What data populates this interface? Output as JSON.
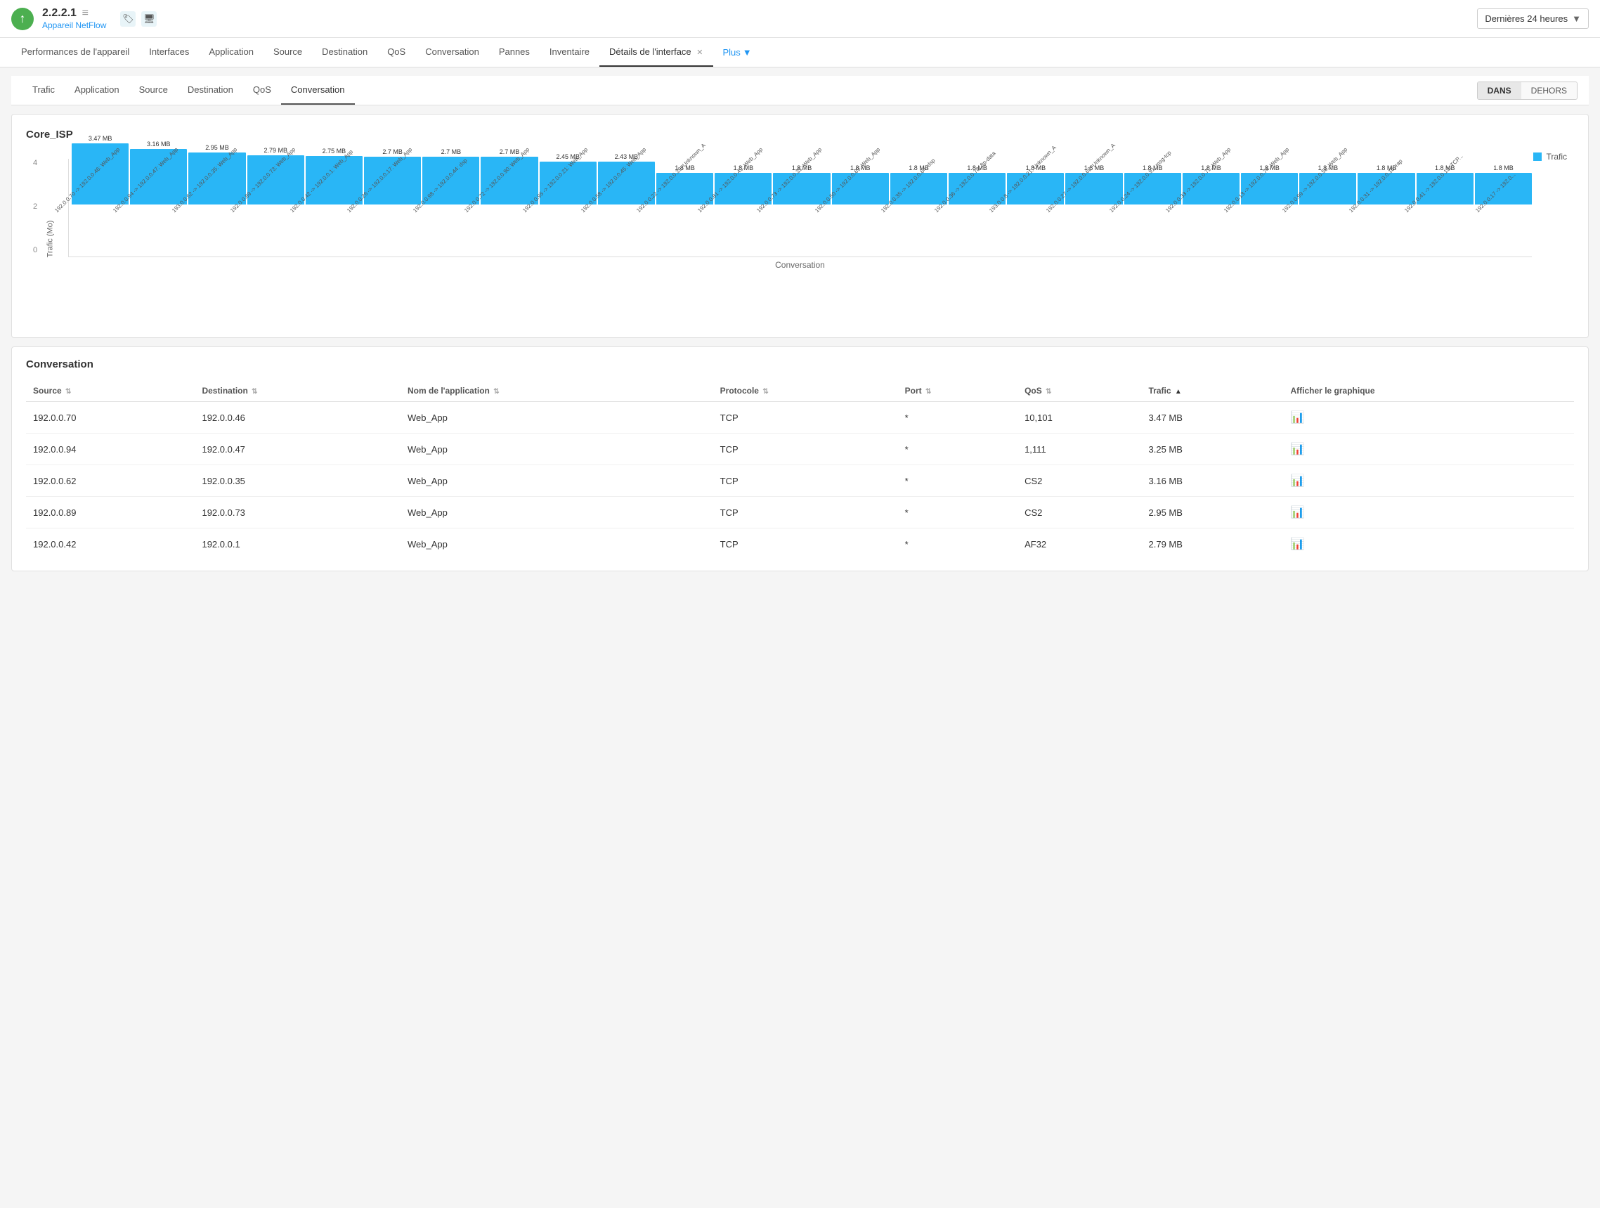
{
  "header": {
    "version": "2.2.2.1",
    "device_link": "Appareil NetFlow",
    "time_selector": "Dernières 24 heures"
  },
  "nav_tabs": [
    {
      "label": "Performances de l'appareil",
      "active": false
    },
    {
      "label": "Interfaces",
      "active": false
    },
    {
      "label": "Application",
      "active": false
    },
    {
      "label": "Source",
      "active": false
    },
    {
      "label": "Destination",
      "active": false
    },
    {
      "label": "QoS",
      "active": false
    },
    {
      "label": "Conversation",
      "active": false
    },
    {
      "label": "Pannes",
      "active": false
    },
    {
      "label": "Inventaire",
      "active": false
    },
    {
      "label": "Détails de l'interface",
      "active": true
    },
    {
      "label": "Plus",
      "active": false
    }
  ],
  "sub_tabs": [
    {
      "label": "Trafic"
    },
    {
      "label": "Application"
    },
    {
      "label": "Source"
    },
    {
      "label": "Destination"
    },
    {
      "label": "QoS"
    },
    {
      "label": "Conversation",
      "active": true
    }
  ],
  "direction_buttons": [
    {
      "label": "DANS",
      "active": true
    },
    {
      "label": "DEHORS",
      "active": false
    }
  ],
  "chart": {
    "title": "Core_ISP",
    "y_label": "Trafic (Mo)",
    "x_label": "Conversation",
    "legend": "Trafic",
    "y_axis": [
      "4",
      "2",
      "0"
    ],
    "bars": [
      {
        "value": "3.47 MB",
        "height": 87,
        "label": "192.0.0.70 -> 192.0.0.46: Web_App"
      },
      {
        "value": "3.16 MB",
        "height": 79,
        "label": "192.0.0.94 -> 192.0.0.47: Web_App"
      },
      {
        "value": "2.95 MB",
        "height": 74,
        "label": "193.0.0.62 -> 192.0.0.35: Web_App"
      },
      {
        "value": "2.79 MB",
        "height": 70,
        "label": "192.0.0.89 -> 192.0.0.73: Web_App"
      },
      {
        "value": "2.75 MB",
        "height": 69,
        "label": "192.0.0.42 -> 192.0.0.1: Web_App"
      },
      {
        "value": "2.7 MB",
        "height": 68,
        "label": "192.0.0.26 -> 192.0.0.17: Web_App"
      },
      {
        "value": "2.7 MB",
        "height": 68,
        "label": "192.0.0.98 -> 192.0.0.44: dsp"
      },
      {
        "value": "2.7 MB",
        "height": 68,
        "label": "192.0.0.72 -> 192.0.0.90: Web_App"
      },
      {
        "value": "2.45 MB",
        "height": 61,
        "label": "192.0.0.95 -> 192.0.0.21: Web_App"
      },
      {
        "value": "2.43 MB",
        "height": 61,
        "label": "192.0.0.58 -> 192.0.0.45: Web_App"
      },
      {
        "value": "1.8 MB",
        "height": 45,
        "label": "192.0.0.22 -> 192.0.0.39: Unknown_A"
      },
      {
        "value": "1.8 MB",
        "height": 45,
        "label": "192.0.0.81 -> 192.0.0.49: Web_App"
      },
      {
        "value": "1.8 MB",
        "height": 45,
        "label": "192.0.0.73 -> 192.0.0.31: Web_App"
      },
      {
        "value": "1.8 MB",
        "height": 45,
        "label": "192.0.0.50 -> 192.0.0.69: Web_App"
      },
      {
        "value": "1.8 MB",
        "height": 45,
        "label": "192.0.0.35 -> 192.0.0.64: dsp"
      },
      {
        "value": "1.8 MB",
        "height": 45,
        "label": "192.0.0.36 -> 192.0.0.78: ftp-data"
      },
      {
        "value": "1.8 MB",
        "height": 45,
        "label": "193.0.0.8 -> 192.0.0.21: Unknown_A"
      },
      {
        "value": "1.8 MB",
        "height": 45,
        "label": "192.0.0.27 -> 192.0.0.62: Unknown_A"
      },
      {
        "value": "1.8 MB",
        "height": 45,
        "label": "192.0.0.24 -> 192.0.0.91: msg-tcp"
      },
      {
        "value": "1.8 MB",
        "height": 45,
        "label": "192.0.0.33 -> 192.0.0.72: Web_App"
      },
      {
        "value": "1.8 MB",
        "height": 45,
        "label": "192.0.0.13 -> 192.0.0.74: Web_App"
      },
      {
        "value": "1.8 MB",
        "height": 45,
        "label": "192.0.0.99 -> 192.0.0.58: Web_App"
      },
      {
        "value": "1.8 MB",
        "height": 45,
        "label": "192.0.0.31 -> 192.0.0.16: rap"
      },
      {
        "value": "1.8 MB",
        "height": 45,
        "label": "192.0.0.41 -> 192.0.0.13: TCP..."
      },
      {
        "value": "1.8 MB",
        "height": 45,
        "label": "192.0.0.17 -> 192.0..."
      }
    ]
  },
  "table": {
    "title": "Conversation",
    "columns": [
      {
        "label": "Source",
        "sort": "both"
      },
      {
        "label": "Destination",
        "sort": "both"
      },
      {
        "label": "Nom de l'application",
        "sort": "both"
      },
      {
        "label": "Protocole",
        "sort": "both"
      },
      {
        "label": "Port",
        "sort": "both"
      },
      {
        "label": "QoS",
        "sort": "both"
      },
      {
        "label": "Trafic",
        "sort": "asc"
      },
      {
        "label": "Afficher le graphique",
        "sort": "none"
      }
    ],
    "rows": [
      {
        "source": "192.0.0.70",
        "destination": "192.0.0.46",
        "app": "Web_App",
        "protocol": "TCP",
        "port": "*",
        "qos": "10,101",
        "trafic": "3.47 MB"
      },
      {
        "source": "192.0.0.94",
        "destination": "192.0.0.47",
        "app": "Web_App",
        "protocol": "TCP",
        "port": "*",
        "qos": "1,111",
        "trafic": "3.25 MB"
      },
      {
        "source": "192.0.0.62",
        "destination": "192.0.0.35",
        "app": "Web_App",
        "protocol": "TCP",
        "port": "*",
        "qos": "CS2",
        "trafic": "3.16 MB"
      },
      {
        "source": "192.0.0.89",
        "destination": "192.0.0.73",
        "app": "Web_App",
        "protocol": "TCP",
        "port": "*",
        "qos": "CS2",
        "trafic": "2.95 MB"
      },
      {
        "source": "192.0.0.42",
        "destination": "192.0.0.1",
        "app": "Web_App",
        "protocol": "TCP",
        "port": "*",
        "qos": "AF32",
        "trafic": "2.79 MB"
      }
    ]
  }
}
